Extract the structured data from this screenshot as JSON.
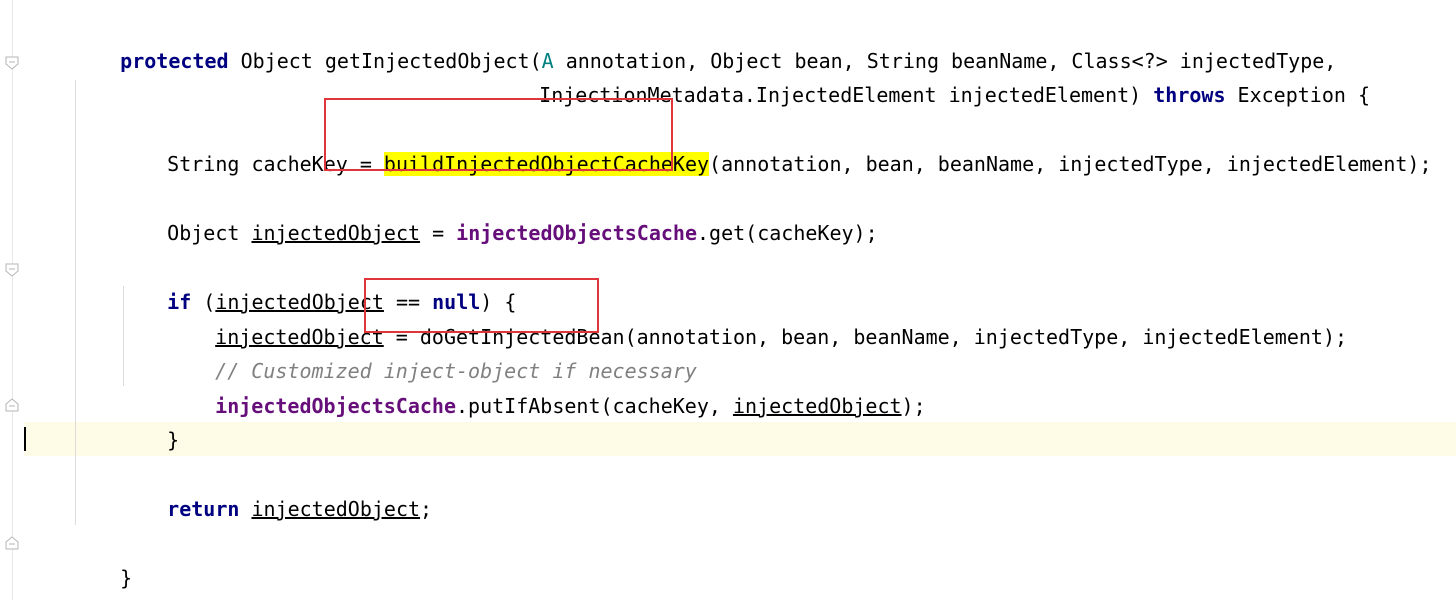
{
  "code": {
    "line1": {
      "kw_protected": "protected",
      "sig_a": " Object getInjectedObject(",
      "annotation_type": "A",
      "sig_b": " annotation, Object bean, String beanName, Class<?> injectedType,"
    },
    "line2": {
      "sig_c": "InjectionMetadata.InjectedElement injectedElement) ",
      "kw_throws": "throws",
      "sig_d": " Exception {"
    },
    "line3": {
      "pre": "String cacheKey = ",
      "method": "buildInjectedObjectCacheKey",
      "args": "(annotation, bean, beanName, injectedType, injectedElement);"
    },
    "line4": {
      "pre": "Object ",
      "var": "injectedObject",
      "eq": " = ",
      "field": "injectedObjectsCache",
      "post": ".get(cacheKey);"
    },
    "line5": {
      "kw_if": "if",
      "open": " (",
      "var": "injectedObject",
      "op": " == ",
      "kw_null": "null",
      "close": ") {"
    },
    "line6": {
      "var": "injectedObject",
      "eq": " = ",
      "method": "doGetInjectedBean",
      "args": "(annotation, bean, beanName, injectedType, injectedElement);"
    },
    "line7": {
      "comment": "// Customized inject-object if necessary"
    },
    "line8": {
      "field": "injectedObjectsCache",
      "mid": ".putIfAbsent(cacheKey, ",
      "var": "injectedObject",
      "end": ");"
    },
    "line9": {
      "brace": "}"
    },
    "line10": {
      "kw_return": "return",
      "sp": " ",
      "var": "injectedObject",
      "end": ";"
    },
    "line11": {
      "brace": "}"
    }
  },
  "colors": {
    "keyword": "#000080",
    "field": "#660e7a",
    "comment": "#808080",
    "annotation": "#008080",
    "highlight": "#ffff00",
    "markup_box": "#e0353a",
    "current_line": "#fefbe7"
  },
  "icons": [
    "fold-open-icon",
    "fold-open-icon",
    "fold-close-icon",
    "fold-close-icon"
  ]
}
